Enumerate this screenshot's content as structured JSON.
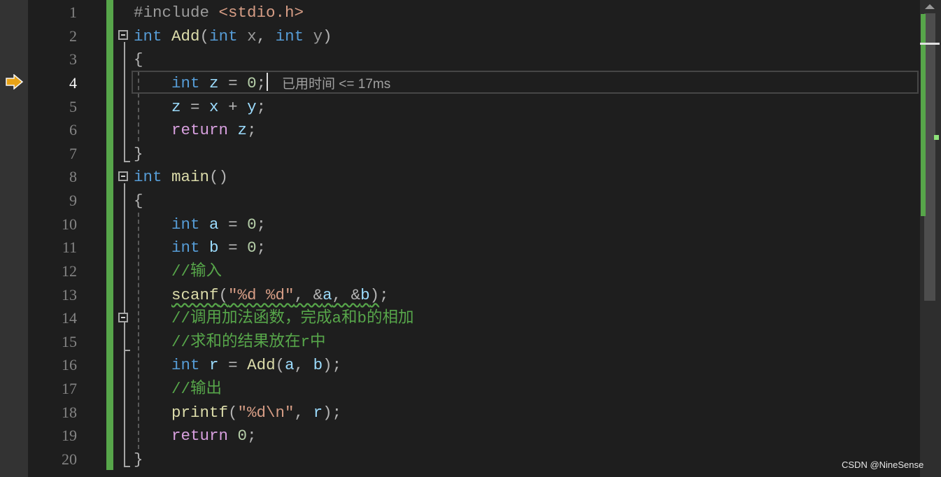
{
  "editor": {
    "current_line": 4,
    "inline_hint": "已用时间 <= 17ms",
    "lines": [
      [
        [
          "#include ",
          "pre"
        ],
        [
          "<stdio.h>",
          "str"
        ]
      ],
      [
        [
          "int",
          "kw"
        ],
        [
          " ",
          ""
        ],
        [
          "Add",
          "fn"
        ],
        [
          "(",
          "pun"
        ],
        [
          "int",
          "kw"
        ],
        [
          " x",
          "par"
        ],
        [
          ", ",
          "pun"
        ],
        [
          "int",
          "kw"
        ],
        [
          " y",
          "par"
        ],
        [
          ")",
          "pun"
        ]
      ],
      [
        [
          "{",
          "pun"
        ]
      ],
      [
        [
          "    ",
          ""
        ],
        [
          "int",
          "kw"
        ],
        [
          " ",
          ""
        ],
        [
          "z",
          "var"
        ],
        [
          " = ",
          "pun"
        ],
        [
          "0",
          "num"
        ],
        [
          ";",
          "pun"
        ]
      ],
      [
        [
          "    ",
          ""
        ],
        [
          "z",
          "var"
        ],
        [
          " = ",
          "pun"
        ],
        [
          "x",
          "var"
        ],
        [
          " + ",
          "pun"
        ],
        [
          "y",
          "var"
        ],
        [
          ";",
          "pun"
        ]
      ],
      [
        [
          "    ",
          ""
        ],
        [
          "return",
          "ctl"
        ],
        [
          " ",
          ""
        ],
        [
          "z",
          "var"
        ],
        [
          ";",
          "pun"
        ]
      ],
      [
        [
          "}",
          "pun"
        ]
      ],
      [
        [
          "int",
          "kw"
        ],
        [
          " ",
          ""
        ],
        [
          "main",
          "fn"
        ],
        [
          "()",
          "pun"
        ]
      ],
      [
        [
          "{",
          "pun"
        ]
      ],
      [
        [
          "    ",
          ""
        ],
        [
          "int",
          "kw"
        ],
        [
          " ",
          ""
        ],
        [
          "a",
          "var"
        ],
        [
          " = ",
          "pun"
        ],
        [
          "0",
          "num"
        ],
        [
          ";",
          "pun"
        ]
      ],
      [
        [
          "    ",
          ""
        ],
        [
          "int",
          "kw"
        ],
        [
          " ",
          ""
        ],
        [
          "b",
          "var"
        ],
        [
          " = ",
          "pun"
        ],
        [
          "0",
          "num"
        ],
        [
          ";",
          "pun"
        ]
      ],
      [
        [
          "    ",
          ""
        ],
        [
          "//输入",
          "com"
        ]
      ],
      [
        [
          "    ",
          ""
        ],
        [
          "scanf",
          "fn squig"
        ],
        [
          "(",
          "pun squig"
        ],
        [
          "\"%d %d\"",
          "str squig"
        ],
        [
          ", &",
          "pun squig"
        ],
        [
          "a",
          "var squig"
        ],
        [
          ", &",
          "pun squig"
        ],
        [
          "b",
          "var squig"
        ],
        [
          ")",
          "pun squig"
        ],
        [
          ";",
          "pun"
        ]
      ],
      [
        [
          "    ",
          ""
        ],
        [
          "//调用加法函数，完成a和b的相加",
          "com"
        ]
      ],
      [
        [
          "    ",
          ""
        ],
        [
          "//求和的结果放在r中",
          "com"
        ]
      ],
      [
        [
          "    ",
          ""
        ],
        [
          "int",
          "kw"
        ],
        [
          " ",
          ""
        ],
        [
          "r",
          "var"
        ],
        [
          " = ",
          "pun"
        ],
        [
          "Add",
          "fn"
        ],
        [
          "(",
          "pun"
        ],
        [
          "a",
          "var"
        ],
        [
          ", ",
          "pun"
        ],
        [
          "b",
          "var"
        ],
        [
          ");",
          "pun"
        ]
      ],
      [
        [
          "    ",
          ""
        ],
        [
          "//输出",
          "com"
        ]
      ],
      [
        [
          "    ",
          ""
        ],
        [
          "printf",
          "fn"
        ],
        [
          "(",
          "pun"
        ],
        [
          "\"%d\\n\"",
          "str"
        ],
        [
          ", ",
          "pun"
        ],
        [
          "r",
          "var"
        ],
        [
          ");",
          "pun"
        ]
      ],
      [
        [
          "    ",
          ""
        ],
        [
          "return",
          "ctl"
        ],
        [
          " ",
          ""
        ],
        [
          "0",
          "num"
        ],
        [
          ";",
          "pun"
        ]
      ],
      [
        [
          "}",
          "pun"
        ]
      ]
    ]
  },
  "icons": {
    "breakpoint_arrow": "current-statement-arrow-icon",
    "fold": "collapse-icon"
  },
  "colors": {
    "keyword": "#569cd6",
    "function": "#dcdcaa",
    "variable": "#9cdcfe",
    "string": "#d69d85",
    "comment": "#57a64a",
    "number": "#b5cea8",
    "control": "#d8a0df",
    "change_bar": "#57a64a",
    "arrow": "#e8a317"
  },
  "watermark": "CSDN @NineSense"
}
